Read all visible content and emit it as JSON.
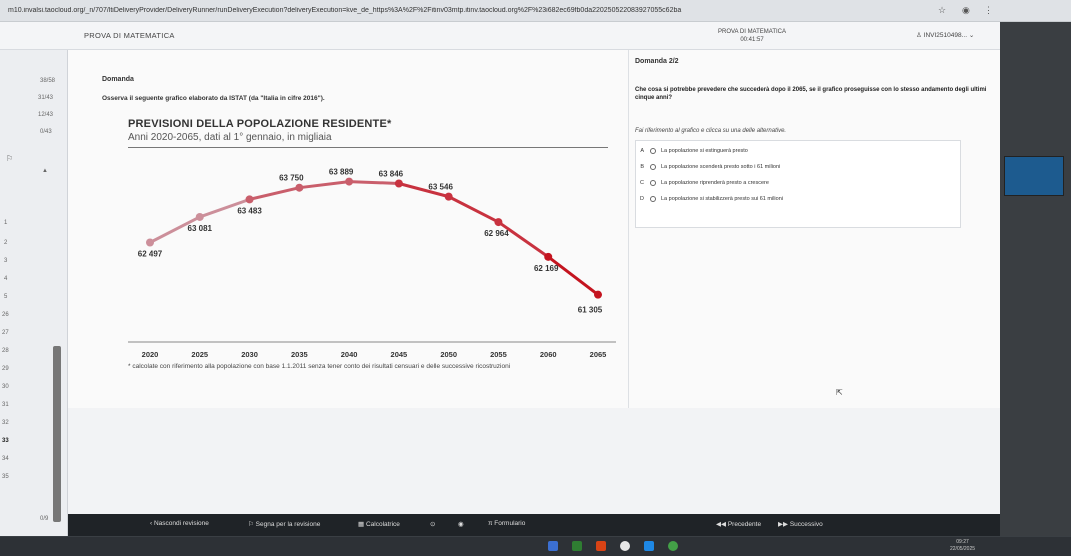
{
  "browser": {
    "url": "m10.invalsi.taocloud.org/_n/707/ltiDeliveryProvider/DeliveryRunner/runDeliveryExecution?deliveryExecution=kve_de_https%3A%2F%2Fitinv03mtp.itinv.taocloud.org%2F%23i682ec69fb0da220250522083927055c62ba"
  },
  "app": {
    "title": "PROVA DI MATEMATICA",
    "center_title": "PROVA DI MATEMATICA",
    "timer": "00:41:57",
    "user": "INVI2510498..."
  },
  "nav": {
    "items": [
      "38/58",
      "31/43",
      "12/43",
      "0/43"
    ],
    "numbers": [
      "1",
      "2",
      "3",
      "4",
      "5",
      "26",
      "27",
      "28",
      "29",
      "30",
      "31",
      "32",
      "33",
      "34",
      "35"
    ],
    "bottom": "0/9"
  },
  "domanda": {
    "label": "Domanda",
    "stem": "Osserva il seguente grafico elaborato da ISTAT (da \"Italia in cifre 2016\")."
  },
  "chart_data": {
    "type": "line",
    "title": "PREVISIONI DELLA POPOLAZIONE RESIDENTE*",
    "subtitle": "Anni 2020-2065, dati al 1° gennaio, in migliaia",
    "x": [
      "2020",
      "2025",
      "2030",
      "2035",
      "2040",
      "2045",
      "2050",
      "2055",
      "2060",
      "2065"
    ],
    "values": [
      62497,
      63081,
      63483,
      63750,
      63889,
      63846,
      63546,
      62964,
      62169,
      61305
    ],
    "labels": [
      "62 497",
      "63 081",
      "63 483",
      "63 750",
      "63 889",
      "63 846",
      "63 546",
      "62 964",
      "62 169",
      "61 305"
    ],
    "footnote": "* calcolate con riferimento alla popolazione con base 1.1.2011 senza tener conto dei risultati censuari e delle successive ricostruzioni",
    "ylim": [
      61000,
      64200
    ],
    "colors": [
      "#cc8f9a",
      "#c95e6b",
      "#c8323f",
      "#c4141f"
    ]
  },
  "question": {
    "label": "Domanda 2/2",
    "text": "Che cosa si potrebbe prevedere che succederà dopo il 2065, se il grafico proseguisse con lo stesso andamento degli ultimi cinque anni?",
    "hint": "Fai riferimento al grafico e clicca su una delle alternative.",
    "options": [
      {
        "letter": "A",
        "text": "La popolazione si estinguerà presto"
      },
      {
        "letter": "B",
        "text": "La popolazione scenderà presto sotto i 61 milioni"
      },
      {
        "letter": "C",
        "text": "La popolazione riprenderà presto a crescere"
      },
      {
        "letter": "D",
        "text": "La popolazione si stabilizzerà presto sui 61 milioni"
      }
    ]
  },
  "toolbar": {
    "hide_review": "Nascondi revisione",
    "flag_review": "Segna per la revisione",
    "calculator": "Calcolatrice",
    "formulary": "Formulario",
    "previous": "Precedente",
    "next": "Successivo"
  },
  "clock": {
    "time": "09:27",
    "date": "22/05/2025"
  }
}
